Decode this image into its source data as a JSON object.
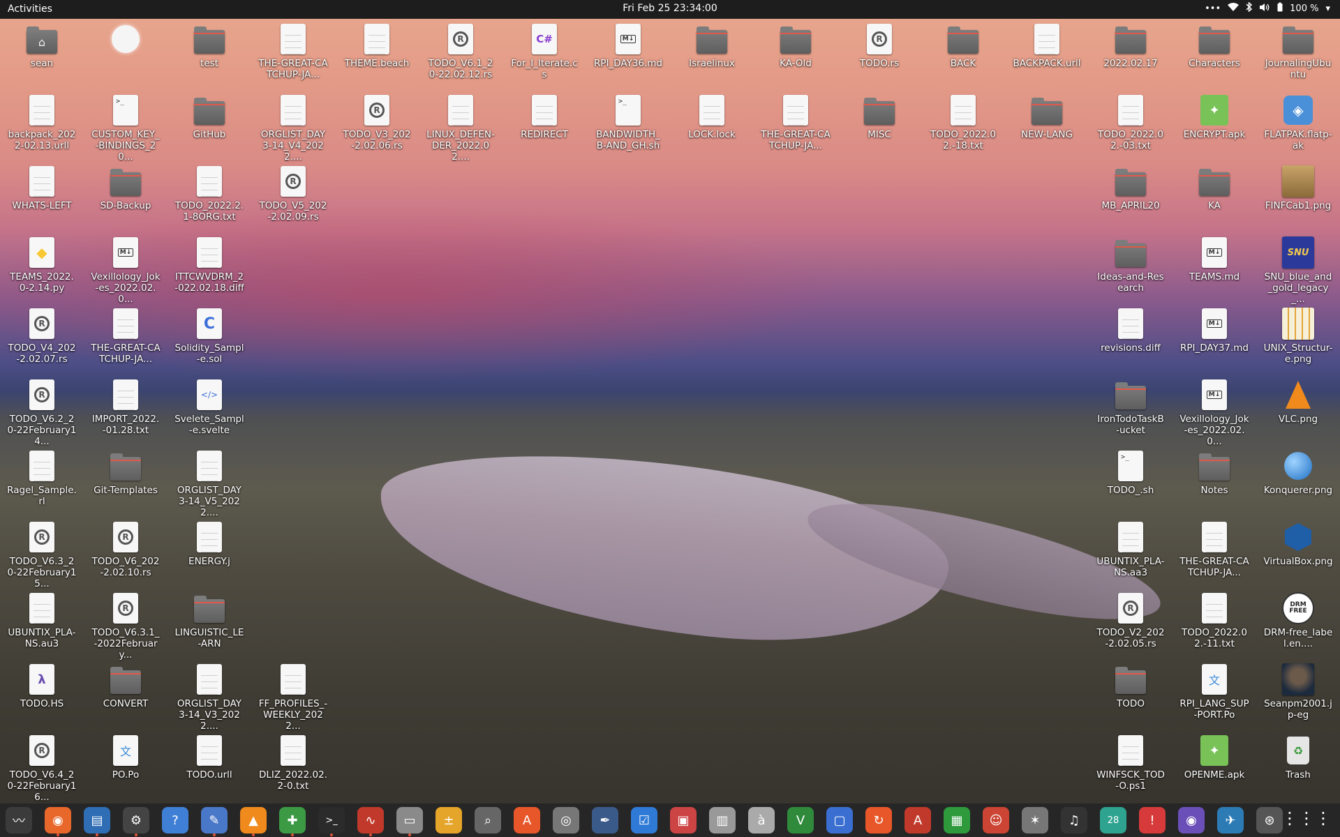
{
  "topbar": {
    "activities": "Activities",
    "clock": "Fri Feb 25  23:34:00",
    "battery": "100 %",
    "menu_dots": "•••"
  },
  "desktop": {
    "icons": [
      {
        "label": "sean",
        "type": "home"
      },
      {
        "label": "",
        "type": "circle"
      },
      {
        "label": "test",
        "type": "folder"
      },
      {
        "label": "THE-GREAT-CATCHUP-JA...",
        "type": "doc"
      },
      {
        "label": "THEME.beach",
        "type": "doc"
      },
      {
        "label": "TODO_V6.1_20-22.02.12.rs",
        "type": "rust"
      },
      {
        "label": "For_I_Iterate.cs",
        "type": "cs"
      },
      {
        "label": "RPI_DAY36.md",
        "type": "md"
      },
      {
        "label": "Israelinux",
        "type": "folder"
      },
      {
        "label": "KA-Old",
        "type": "folder"
      },
      {
        "label": "TODO.rs",
        "type": "rust"
      },
      {
        "label": "BACK",
        "type": "folder"
      },
      {
        "label": "BACKPACK.urll",
        "type": "doc"
      },
      {
        "label": "2022.02.17",
        "type": "folder"
      },
      {
        "label": "Characters",
        "type": "folder"
      },
      {
        "label": "JournalingUbuntu",
        "type": "folder"
      },
      {
        "label": "backpack_2022-02.13.urll",
        "type": "doc"
      },
      {
        "label": "CUSTOM_KEY_-BINDINGS_20...",
        "type": "term"
      },
      {
        "label": "GitHub",
        "type": "folder"
      },
      {
        "label": "ORGLIST_DAY3-14_V4_2022....",
        "type": "doc"
      },
      {
        "label": "TODO_V3_202-2.02.06.rs",
        "type": "rust"
      },
      {
        "label": "LINUX_DEFEN-DER_2022.02....",
        "type": "doc"
      },
      {
        "label": "REDIRECT",
        "type": "doc"
      },
      {
        "label": "BANDWIDTH_B-AND_GH.sh",
        "type": "term"
      },
      {
        "label": "LOCK.lock",
        "type": "doc"
      },
      {
        "label": "THE-GREAT-CATCHUP-JA...",
        "type": "doc"
      },
      {
        "label": "MISC",
        "type": "folder"
      },
      {
        "label": "TODO_2022.02.-18.txt",
        "type": "doc"
      },
      {
        "label": "NEW-LANG",
        "type": "folder"
      },
      {
        "label": "TODO_2022.02.-03.txt",
        "type": "doc"
      },
      {
        "label": "ENCRYPT.apk",
        "type": "apk"
      },
      {
        "label": "FLATPAK.flatp-ak",
        "type": "flatpak"
      },
      {
        "label": "WHATS-LEFT",
        "type": "doc"
      },
      {
        "label": "SD-Backup",
        "type": "folder"
      },
      {
        "label": "TODO_2022.2.1-8ORG.txt",
        "type": "doc"
      },
      {
        "label": "TODO_V5_202-2.02.09.rs",
        "type": "rust"
      },
      {
        "label": "MB_APRIL20",
        "type": "folder"
      },
      {
        "label": "KA",
        "type": "folder"
      },
      {
        "label": "FINFCab1.png",
        "type": "img-cab"
      },
      {
        "label": "TEAMS_2022.0-2.14.py",
        "type": "py"
      },
      {
        "label": "Vexillology_Jok-es_2022.02.0...",
        "type": "md"
      },
      {
        "label": "ITTCWVDRM_2-022.02.18.diff",
        "type": "doc"
      },
      {
        "label": "Ideas-and-Research",
        "type": "folder"
      },
      {
        "label": "TEAMS.md",
        "type": "md"
      },
      {
        "label": "SNU_blue_and_gold_legacy_...",
        "type": "img-snu"
      },
      {
        "label": "TODO_V4_202-2.02.07.rs",
        "type": "rust"
      },
      {
        "label": "THE-GREAT-CATCHUP-JA...",
        "type": "doc"
      },
      {
        "label": "Solidity_Sampl-e.sol",
        "type": "c"
      },
      {
        "label": "revisions.diff",
        "type": "doc"
      },
      {
        "label": "RPI_DAY37.md",
        "type": "md"
      },
      {
        "label": "UNIX_Structur-e.png",
        "type": "img-unix"
      },
      {
        "label": "TODO_V6.2_20-22February14...",
        "type": "rust"
      },
      {
        "label": "IMPORT_2022.-01.28.txt",
        "type": "doc"
      },
      {
        "label": "Svelete_Sampl-e.svelte",
        "type": "code"
      },
      {
        "label": "IronTodoTaskB-ucket",
        "type": "folder"
      },
      {
        "label": "Vexillology_Jok-es_2022.02.0...",
        "type": "md"
      },
      {
        "label": "VLC.png",
        "type": "img-vlc"
      },
      {
        "label": "Ragel_Sample.rl",
        "type": "doc"
      },
      {
        "label": "Git-Templates",
        "type": "folder"
      },
      {
        "label": "ORGLIST_DAY3-14_V5_2022....",
        "type": "doc"
      },
      {
        "label": "TODO_.sh",
        "type": "term"
      },
      {
        "label": "Notes",
        "type": "folder"
      },
      {
        "label": "Konquerer.png",
        "type": "img-konq"
      },
      {
        "label": "TODO_V6.3_20-22February15...",
        "type": "rust"
      },
      {
        "label": "TODO_V6_202-2.02.10.rs",
        "type": "rust"
      },
      {
        "label": "ENERGY.j",
        "type": "doc"
      },
      {
        "label": "UBUNTIX_PLA-NS.aa3",
        "type": "doc"
      },
      {
        "label": "THE-GREAT-CATCHUP-JA...",
        "type": "doc"
      },
      {
        "label": "VirtualBox.png",
        "type": "img-vbox"
      },
      {
        "label": "UBUNTIX_PLA-NS.au3",
        "type": "doc"
      },
      {
        "label": "TODO_V6.3.1_-2022February...",
        "type": "rust"
      },
      {
        "label": "LINGUISTIC_LE-ARN",
        "type": "folder"
      },
      {
        "label": "TODO_V2_202-2.02.05.rs",
        "type": "rust"
      },
      {
        "label": "TODO_2022.02.-11.txt",
        "type": "doc"
      },
      {
        "label": "DRM-free_label.en....",
        "type": "img-drm"
      },
      {
        "label": "TODO.HS",
        "type": "hs"
      },
      {
        "label": "CONVERT",
        "type": "folder"
      },
      {
        "label": "ORGLIST_DAY3-14_V3_2022....",
        "type": "doc"
      },
      {
        "label": "FF_PROFILES_-WEEKLY_2022...",
        "type": "doc"
      },
      {
        "label": "TODO",
        "type": "folder"
      },
      {
        "label": "RPI_LANG_SUP-PORT.Po",
        "type": "po"
      },
      {
        "label": "Seanpm2001.jp-eg",
        "type": "img-photo"
      },
      {
        "label": "TODO_V6.4_20-22February16...",
        "type": "rust"
      },
      {
        "label": "PO.Po",
        "type": "po"
      },
      {
        "label": "TODO.urll",
        "type": "doc"
      },
      {
        "label": "DLIZ_2022.02.2-0.txt",
        "type": "doc"
      },
      {
        "label": "WINFSCK_TOD-O.ps1",
        "type": "doc"
      },
      {
        "label": "OPENME.apk",
        "type": "apk"
      },
      {
        "label": "Trash",
        "type": "trash"
      }
    ]
  },
  "dock": {
    "apps": [
      {
        "name": "system-monitor-icon",
        "glyph": "〰",
        "color": "#3b3b3b",
        "running": false
      },
      {
        "name": "firefox-icon",
        "glyph": "◉",
        "color": "#e8672a",
        "running": true
      },
      {
        "name": "text-editor-icon",
        "glyph": "▤",
        "color": "#2f6db5",
        "running": true
      },
      {
        "name": "settings-icon",
        "glyph": "⚙",
        "color": "#444",
        "running": true
      },
      {
        "name": "help-icon",
        "glyph": "?",
        "color": "#3f7fd6",
        "running": false
      },
      {
        "name": "gedit-icon",
        "glyph": "✎",
        "color": "#4a78c8",
        "running": true
      },
      {
        "name": "vlc-icon",
        "glyph": "▲",
        "color": "#f08a1c",
        "running": true
      },
      {
        "name": "calculator-plus-icon",
        "glyph": "✚",
        "color": "#3c9a45",
        "running": true
      },
      {
        "name": "terminal-icon",
        "glyph": ">_",
        "color": "#2b2b2b",
        "running": true
      },
      {
        "name": "waveform-icon",
        "glyph": "∿",
        "color": "#c0392b",
        "running": true
      },
      {
        "name": "files-icon",
        "glyph": "▭",
        "color": "#8a8a8a",
        "running": true
      },
      {
        "name": "calculator-icon",
        "glyph": "±",
        "color": "#e5a42a",
        "running": false
      },
      {
        "name": "image-viewer-icon",
        "glyph": "⌕",
        "color": "#666",
        "running": false
      },
      {
        "name": "software-center-icon",
        "glyph": "A",
        "color": "#e8572a",
        "running": false
      },
      {
        "name": "disc-icon",
        "glyph": "◎",
        "color": "#777",
        "running": false
      },
      {
        "name": "inkscape-icon",
        "glyph": "✒",
        "color": "#3a5a8a",
        "running": false
      },
      {
        "name": "todo-icon",
        "glyph": "☑",
        "color": "#2f7ad6",
        "running": false
      },
      {
        "name": "screenshot-icon",
        "glyph": "▣",
        "color": "#c44",
        "running": false
      },
      {
        "name": "archive-icon",
        "glyph": "▥",
        "color": "#999",
        "running": false
      },
      {
        "name": "character-map-icon",
        "glyph": "à",
        "color": "#aaa",
        "running": false
      },
      {
        "name": "vim-icon",
        "glyph": "V",
        "color": "#2f8a3c",
        "running": false
      },
      {
        "name": "workspaces-icon",
        "glyph": "▢",
        "color": "#3a6fd1",
        "running": false
      },
      {
        "name": "update-icon",
        "glyph": "↻",
        "color": "#e8572a",
        "running": false
      },
      {
        "name": "pdf-viewer-icon",
        "glyph": "A",
        "color": "#c0392b",
        "running": false
      },
      {
        "name": "spreadsheet-icon",
        "glyph": "▦",
        "color": "#2e9a3c",
        "running": false
      },
      {
        "name": "game-character-icon",
        "glyph": "☺",
        "color": "#c43",
        "running": false
      },
      {
        "name": "gimp-icon",
        "glyph": "✶",
        "color": "#777",
        "running": false
      },
      {
        "name": "music-icon",
        "glyph": "♫",
        "color": "#333",
        "running": false
      },
      {
        "name": "calendar-icon",
        "glyph": "28",
        "color": "#2ea38f",
        "running": false
      },
      {
        "name": "alert-icon",
        "glyph": "!",
        "color": "#d63a3a",
        "running": false
      },
      {
        "name": "camera-icon",
        "glyph": "◉",
        "color": "#6b4fb8",
        "running": false
      },
      {
        "name": "gnome-icon",
        "glyph": "✈",
        "color": "#2d7bb5",
        "running": false
      },
      {
        "name": "git-icon",
        "glyph": "⊛",
        "color": "#555",
        "running": false
      }
    ],
    "show_apps_glyph": "⋮⋮⋮"
  }
}
